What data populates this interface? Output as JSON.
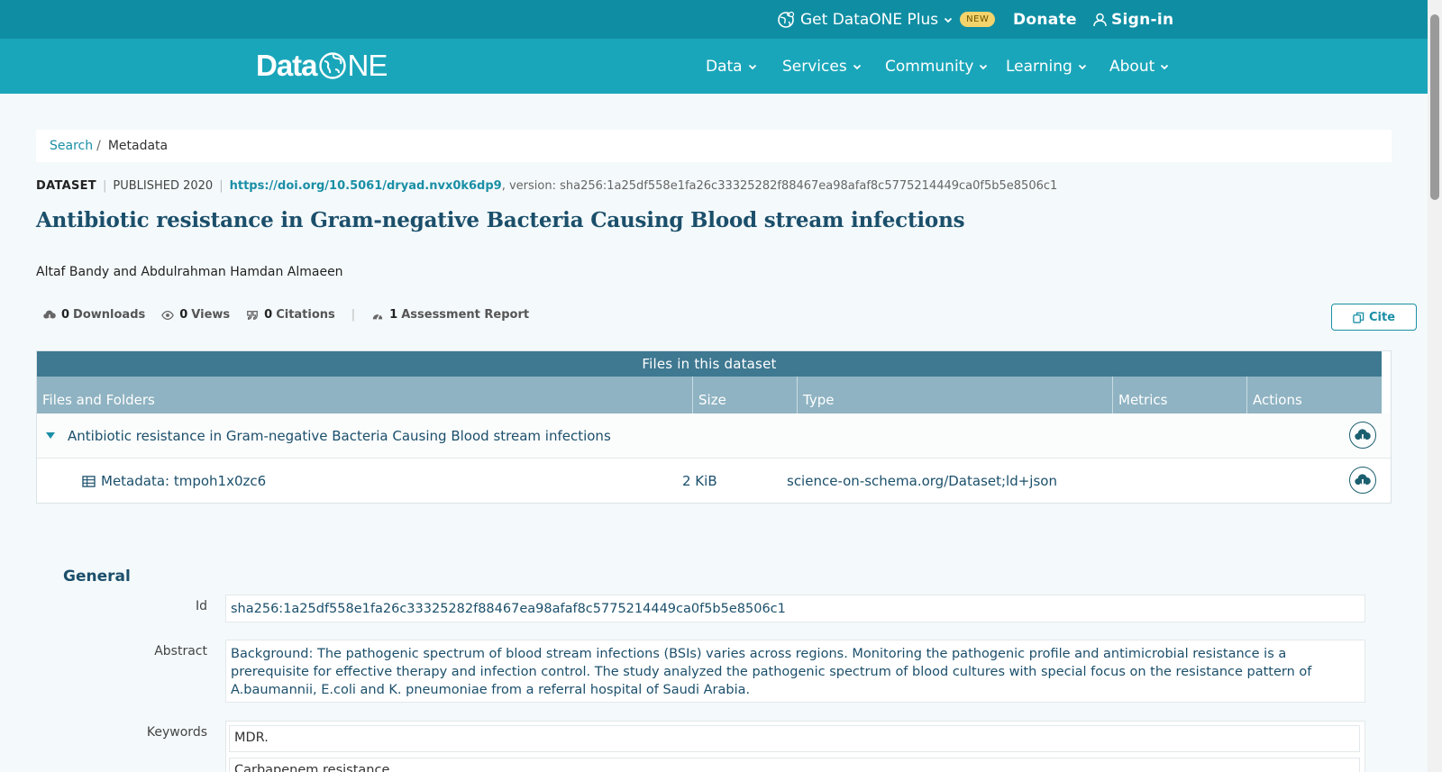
{
  "topbar": {
    "plus_label": "Get DataONE Plus",
    "plus_badge": "NEW",
    "donate_label": "Donate",
    "signin_label": "Sign-in"
  },
  "logo": {
    "text_data": "Data",
    "text_one": "NE"
  },
  "nav": [
    "Data",
    "Services",
    "Community",
    "Learning",
    "About"
  ],
  "breadcrumb": {
    "search": "Search",
    "separator": "/",
    "current": "Metadata"
  },
  "citation": {
    "type": "DATASET",
    "published": "PUBLISHED 2020",
    "doi": "https://doi.org/10.5061/dryad.nvx0k6dp9",
    "version": ", version: sha256:1a25df558e1fa26c33325282f88467ea98afaf8c5775214449ca0f5b5e8506c1"
  },
  "title": "Antibiotic resistance in Gram-negative Bacteria Causing Blood stream infections",
  "authors": "Altaf Bandy and Abdulrahman Hamdan Almaeen",
  "metrics": {
    "downloads_count": "0",
    "downloads_label": "Downloads",
    "views_count": "0",
    "views_label": "Views",
    "citations_count": "0",
    "citations_label": "Citations",
    "assessment_count": "1",
    "assessment_label": "Assessment Report"
  },
  "cite_label": "Cite",
  "files": {
    "caption": "Files in this dataset",
    "headers": [
      "Files and Folders",
      "Size",
      "Type",
      "Metrics",
      "Actions"
    ],
    "folder_name": "Antibiotic resistance in Gram-negative Bacteria Causing Blood stream infections",
    "metadata_name": "Metadata: tmpoh1x0zc6",
    "metadata_size": "2 KiB",
    "metadata_type": "science-on-schema.org/Dataset;ld+json"
  },
  "general": {
    "title": "General",
    "id_label": "Id",
    "id_value": "sha256:1a25df558e1fa26c33325282f88467ea98afaf8c5775214449ca0f5b5e8506c1",
    "abstract_label": "Abstract",
    "abstract_value": "Background: The pathogenic spectrum of blood stream infections (BSIs) varies across regions. Monitoring the pathogenic profile and antimicrobial resistance is a prerequisite for effective therapy and infection control. The study analyzed the pathogenic spectrum of blood cultures with special focus on the resistance pattern of A.baumannii, E.coli and K. pneumoniae from a referral hospital of Saudi Arabia.",
    "keywords_label": "Keywords",
    "keywords": [
      "MDR.",
      "Carbapenem resistance"
    ]
  },
  "colors": {
    "topbar": "#0f8ea3",
    "navbar": "#1aa6ba",
    "accent": "#1a8fa6",
    "title": "#1b4f6b",
    "table_caption": "#3e7891",
    "table_head": "#8fb3c2"
  }
}
